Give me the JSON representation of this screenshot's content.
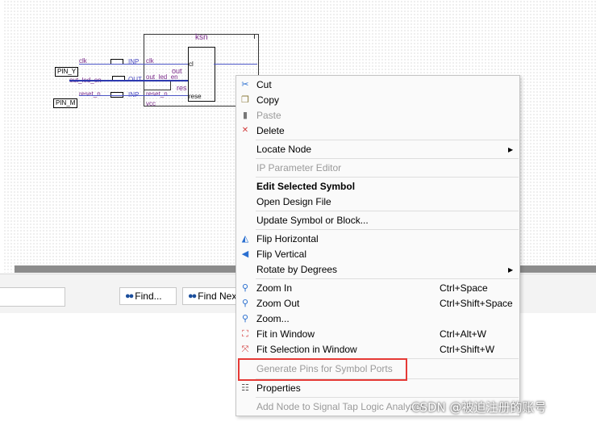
{
  "schematic": {
    "block_name": "ksn",
    "pin_left_1": "PIN_Y",
    "pin_left_2": "PIN_M",
    "sig_clk": "clk",
    "sig_out_led": "out_led_en",
    "sig_reset": "reset_n",
    "port_clk": "clk",
    "port_out": "out_led_en",
    "port_reset": "reset_n",
    "port_vcc": "vcc",
    "inner_1": "cl",
    "inner_2": "out",
    "inner_3": "res",
    "inner_4": "rese",
    "tag_in": "INP",
    "tag_out": "OUT"
  },
  "toolbar": {
    "find_label": "Find...",
    "find_next_label": "Find Next"
  },
  "context_menu": {
    "items": [
      {
        "label": "Cut",
        "shortcut": "",
        "icon": "scissors-icon"
      },
      {
        "label": "Copy",
        "shortcut": "",
        "icon": "copy-icon"
      },
      {
        "label": "Paste",
        "shortcut": "",
        "icon": "paste-icon",
        "disabled": true
      },
      {
        "label": "Delete",
        "shortcut": "",
        "icon": "delete-icon"
      },
      {
        "label": "Locate Node",
        "shortcut": "",
        "submenu": true
      },
      {
        "label": "IP Parameter Editor",
        "shortcut": "",
        "disabled": true
      },
      {
        "label": "Edit Selected Symbol",
        "shortcut": "",
        "bold": true
      },
      {
        "label": "Open Design File",
        "shortcut": ""
      },
      {
        "label": "Update Symbol or Block...",
        "shortcut": ""
      },
      {
        "label": "Flip Horizontal",
        "shortcut": "",
        "icon": "flip-horizontal-icon"
      },
      {
        "label": "Flip Vertical",
        "shortcut": "",
        "icon": "flip-vertical-icon"
      },
      {
        "label": "Rotate by Degrees",
        "shortcut": "",
        "submenu": true
      },
      {
        "label": "Zoom In",
        "shortcut": "Ctrl+Space",
        "icon": "zoom-in-icon"
      },
      {
        "label": "Zoom Out",
        "shortcut": "Ctrl+Shift+Space",
        "icon": "zoom-out-icon"
      },
      {
        "label": "Zoom...",
        "shortcut": "",
        "icon": "zoom-icon"
      },
      {
        "label": "Fit in Window",
        "shortcut": "Ctrl+Alt+W",
        "icon": "fit-window-icon"
      },
      {
        "label": "Fit Selection in Window",
        "shortcut": "Ctrl+Shift+W",
        "icon": "fit-selection-icon"
      },
      {
        "label": "Generate Pins for Symbol Ports",
        "shortcut": "",
        "disabled": true
      },
      {
        "label": "Properties",
        "shortcut": "",
        "icon": "properties-icon"
      },
      {
        "label": "Add Node to Signal Tap Logic Analyzer",
        "shortcut": "",
        "disabled": true
      }
    ]
  },
  "highlight_color": "#e53935",
  "watermark": "CSDN @被迫注册的账号"
}
